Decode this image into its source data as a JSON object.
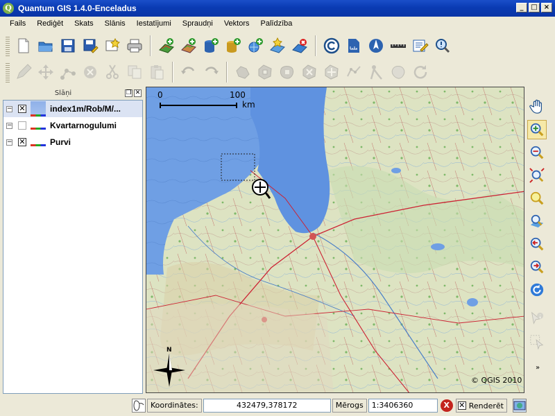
{
  "window": {
    "title": "Quantum GIS 1.4.0-Enceladus",
    "app_icon_letter": "Q",
    "min_glyph": "_",
    "max_glyph": "□",
    "close_glyph": "×"
  },
  "menu": [
    "Fails",
    "Rediģēt",
    "Skats",
    "Slānis",
    "Iestatījumi",
    "Spraudņi",
    "Vektors",
    "Palīdzība"
  ],
  "toolbar1": [
    {
      "name": "new-project-icon"
    },
    {
      "name": "open-project-icon"
    },
    {
      "name": "save-project-icon"
    },
    {
      "name": "save-as-icon"
    },
    {
      "name": "new-print-composer-icon"
    },
    {
      "name": "print-icon"
    },
    {
      "name": "add-vector-layer-icon"
    },
    {
      "name": "add-raster-layer-icon"
    },
    {
      "name": "add-postgis-layer-icon"
    },
    {
      "name": "add-spatialite-layer-icon"
    },
    {
      "name": "add-wms-layer-icon"
    },
    {
      "name": "new-vector-layer-icon"
    },
    {
      "name": "remove-layer-icon"
    },
    {
      "name": "copyright-label-icon"
    },
    {
      "name": "scale-bar-icon"
    },
    {
      "name": "north-arrow-icon"
    },
    {
      "name": "measure-icon"
    },
    {
      "name": "annotation-icon"
    },
    {
      "name": "identify-icon"
    }
  ],
  "toolbar2": [
    {
      "name": "toggle-editing-icon"
    },
    {
      "name": "move-feature-icon"
    },
    {
      "name": "node-tool-icon"
    },
    {
      "name": "delete-selected-icon"
    },
    {
      "name": "cut-features-icon"
    },
    {
      "name": "copy-features-icon"
    },
    {
      "name": "paste-features-icon"
    },
    {
      "name": "undo-icon"
    },
    {
      "name": "redo-icon"
    },
    {
      "name": "simplify-feature-icon"
    },
    {
      "name": "add-ring-icon"
    },
    {
      "name": "add-island-icon"
    },
    {
      "name": "delete-ring-icon"
    },
    {
      "name": "delete-part-icon"
    },
    {
      "name": "reshape-features-icon"
    },
    {
      "name": "split-features-icon"
    },
    {
      "name": "merge-features-icon"
    },
    {
      "name": "rotate-feature-icon"
    }
  ],
  "layers_panel": {
    "title": "Slāņi",
    "layers": [
      {
        "name": "index1m/Rob/M/...",
        "checked": true,
        "type": "raster",
        "expanded": true
      },
      {
        "name": "Kvartarnogulumi",
        "checked": false,
        "type": "vector",
        "expanded": true
      },
      {
        "name": "Purvi",
        "checked": true,
        "type": "vector",
        "expanded": true
      }
    ]
  },
  "map": {
    "scalebar_left": "0",
    "scalebar_right": "100",
    "scalebar_unit": "km",
    "north_label": "N",
    "copyright": "© QGIS 2010",
    "sea_color": "#6fa0e6",
    "land_color": "#dfe4c4"
  },
  "right_tools": [
    {
      "name": "pan-icon",
      "active": false
    },
    {
      "name": "zoom-in-icon",
      "active": true
    },
    {
      "name": "zoom-out-icon",
      "active": false
    },
    {
      "name": "zoom-full-icon",
      "active": false
    },
    {
      "name": "zoom-to-selection-icon",
      "active": false
    },
    {
      "name": "zoom-to-layer-icon",
      "active": false
    },
    {
      "name": "zoom-last-icon",
      "active": false
    },
    {
      "name": "zoom-next-icon",
      "active": false
    },
    {
      "name": "refresh-icon",
      "active": false
    },
    {
      "name": "identify-features-icon",
      "active": false
    },
    {
      "name": "select-features-icon",
      "active": false
    }
  ],
  "status": {
    "coord_label": "Koordinātes:",
    "coord_value": "432479,378172",
    "scale_label": "Mērogs",
    "scale_value": "1:3406360",
    "stop_glyph": "X",
    "render_label": "Renderēt",
    "render_checked": true
  }
}
